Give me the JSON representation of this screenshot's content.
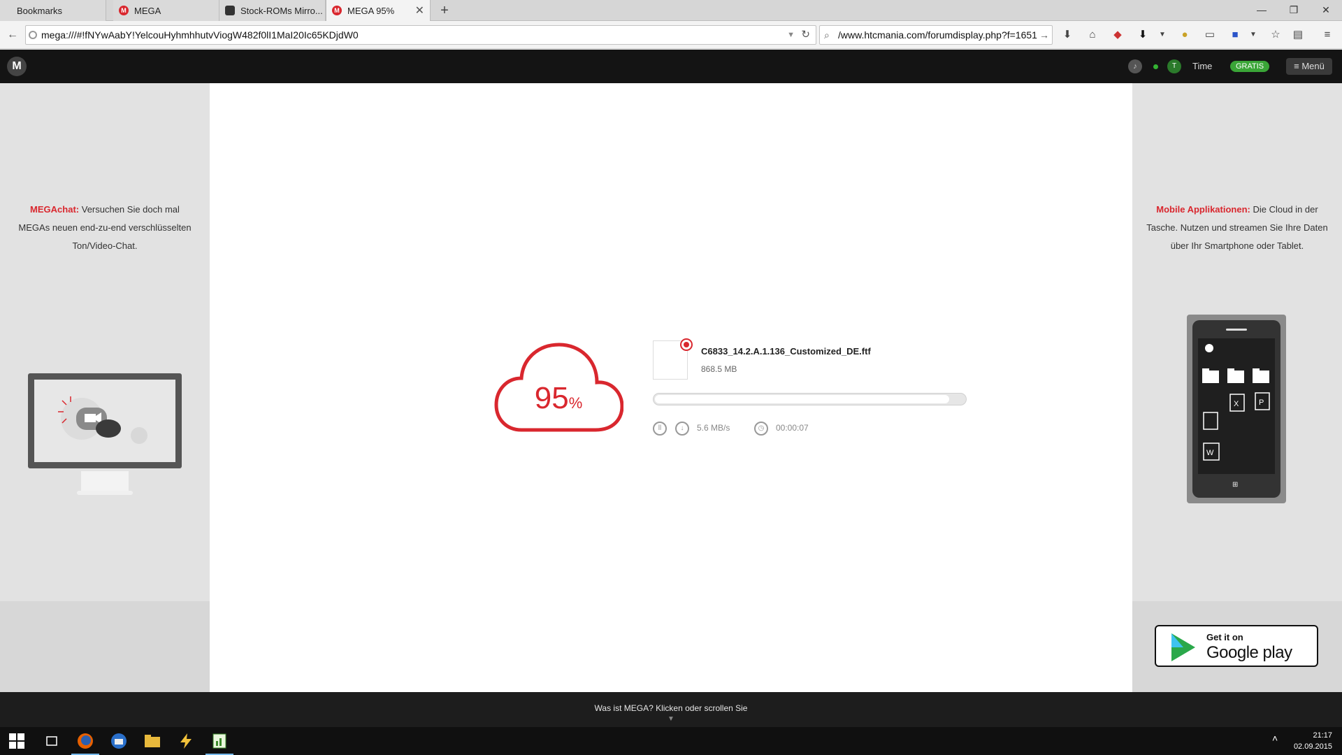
{
  "browser": {
    "tabs": [
      {
        "label": "Bookmarks",
        "icon": "none",
        "active": false
      },
      {
        "label": "MEGA",
        "icon": "mega-icon",
        "active": false
      },
      {
        "label": "Stock-ROMs Mirro...",
        "icon": "android-icon",
        "active": false
      },
      {
        "label": "MEGA 95%",
        "icon": "mega-icon",
        "active": true
      }
    ],
    "new_tab": "+",
    "url": "mega:///#!fNYwAabY!YelcouHyhmhhutvViogW482f0lI1MaI20Ic65KDjdW0",
    "search": "/www.htcmania.com/forumdisplay.php?f=1651"
  },
  "mega_header": {
    "logo": "M",
    "username": "Time",
    "plan_badge": "GRATIS",
    "menu_label": "Menü"
  },
  "left_promo": {
    "highlight": "MEGAchat:",
    "text": "Versuchen Sie doch mal MEGAs neuen end-zu-end verschlüsselten Ton/Video-Chat."
  },
  "right_promo": {
    "highlight": "Mobile Applikationen:",
    "text": "Die Cloud in der Tasche. Nutzen und streamen Sie Ihre Daten über Ihr Smartphone oder Tablet."
  },
  "google_play": {
    "line1": "Get it on",
    "line2": "Google play"
  },
  "download": {
    "percent": "95",
    "percent_sign": "%",
    "filename": "C6833_14.2.A.1.136_Customized_DE.ftf",
    "filesize": "868.5 MB",
    "progress": 0.95,
    "speed": "5.6 MB/s",
    "eta": "00:00:07"
  },
  "footer": {
    "text": "Was ist MEGA? Klicken oder scrollen Sie"
  },
  "taskbar": {
    "time": "21:17",
    "date": "02.09.2015"
  },
  "colors": {
    "mega_red": "#d9272e",
    "gratis_green": "#3aa537"
  }
}
